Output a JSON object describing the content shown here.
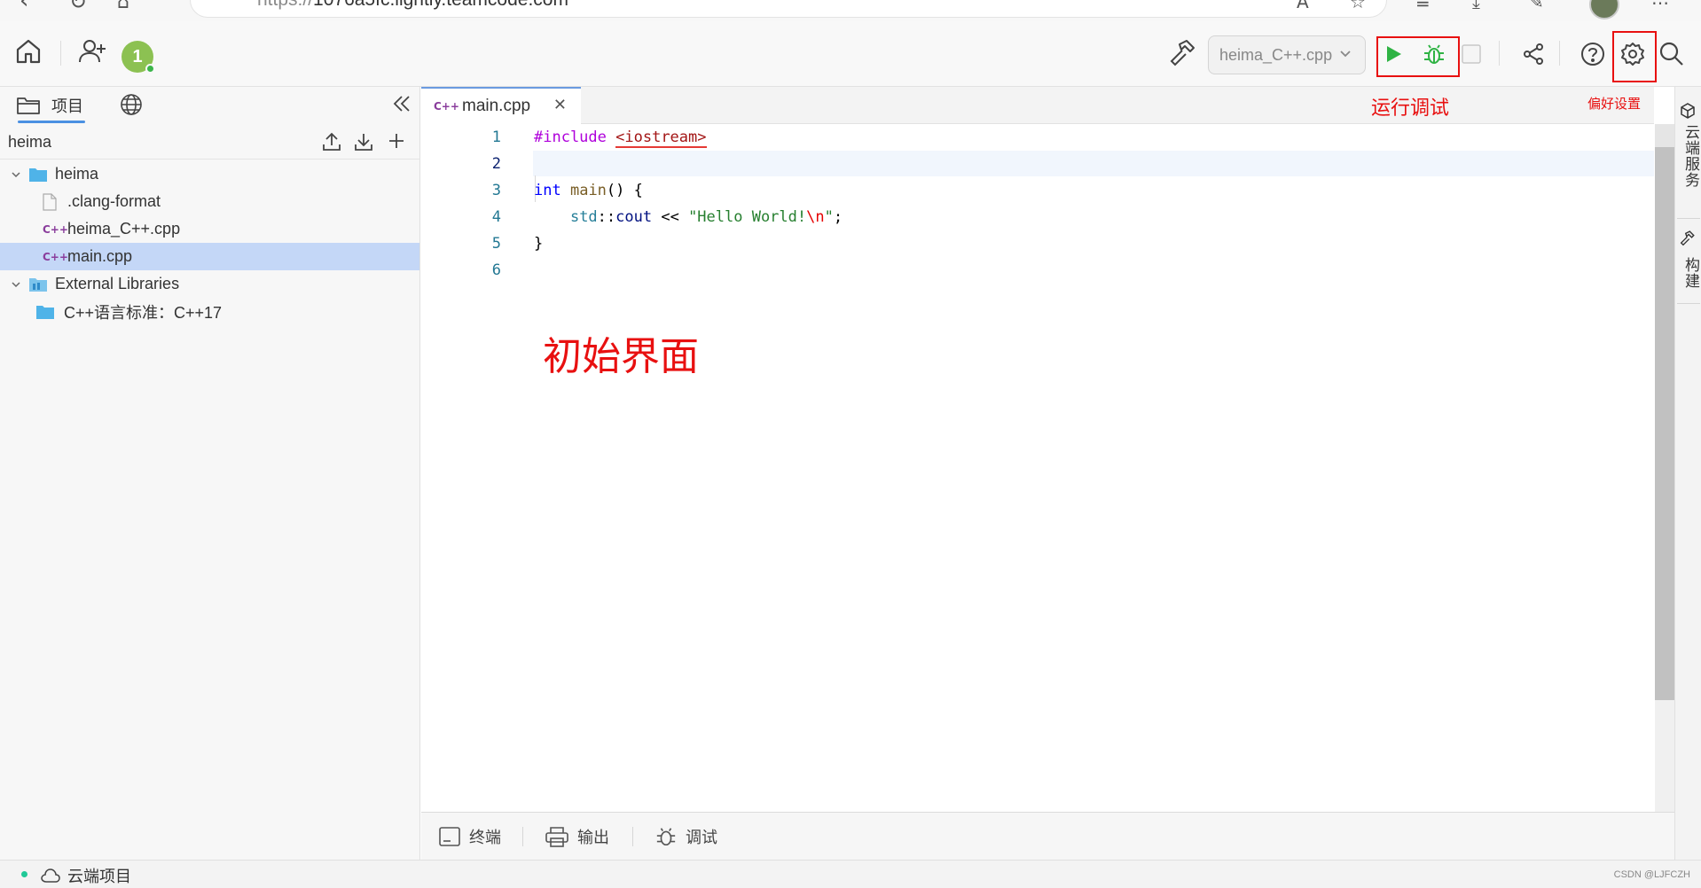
{
  "browser": {
    "url_scheme": "https://",
    "url_host": "1076a5fc.lightly.teamcode.com"
  },
  "toolbar": {
    "user_badge": "1",
    "build_target": "heima_C++.cpp"
  },
  "sidebar": {
    "tab_label": "项目",
    "project_name": "heima",
    "tree": [
      {
        "label": "heima",
        "type": "folder",
        "depth": 0,
        "expanded": true
      },
      {
        "label": ".clang-format",
        "type": "file",
        "depth": 1
      },
      {
        "label": "heima_C++.cpp",
        "type": "cpp",
        "depth": 1
      },
      {
        "label": "main.cpp",
        "type": "cpp",
        "depth": 1,
        "selected": true
      },
      {
        "label": "External Libraries",
        "type": "library",
        "depth": 0,
        "expanded": true
      },
      {
        "label": "C++语言标准：C++17",
        "type": "folder",
        "depth": 1
      }
    ]
  },
  "editor": {
    "tab_label": "main.cpp",
    "file_glyph": "C++",
    "line_numbers": [
      "1",
      "2",
      "3",
      "4",
      "5",
      "6"
    ],
    "code": {
      "l1_directive": "#include",
      "l1_header": "<iostream>",
      "l3_type": "int",
      "l3_name": "main",
      "l3_rest": "() {",
      "l4_ns": "std",
      "l4_sep": "::",
      "l4_obj": "cout",
      "l4_op": " << ",
      "l4_str": "\"Hello World!",
      "l4_esc": "\\n",
      "l4_str_end": "\"",
      "l4_semi": ";",
      "l5_close": "}"
    }
  },
  "annotations": {
    "run_debug": "运行调试",
    "preferences": "偏好设置",
    "initial_ui": "初始界面"
  },
  "right_strip": {
    "cloud_services": "云端服务",
    "build": "构建"
  },
  "bottom_panel": {
    "terminal": "终端",
    "output": "输出",
    "debug": "调试"
  },
  "status_bar": {
    "cloud_project": "云端项目",
    "watermark": "CSDN @LJFCZH"
  },
  "colors": {
    "annotation_red": "#e81010",
    "run_green": "#2fb344",
    "selection": "#c4d7f7",
    "accent_blue": "#4a90e2"
  }
}
